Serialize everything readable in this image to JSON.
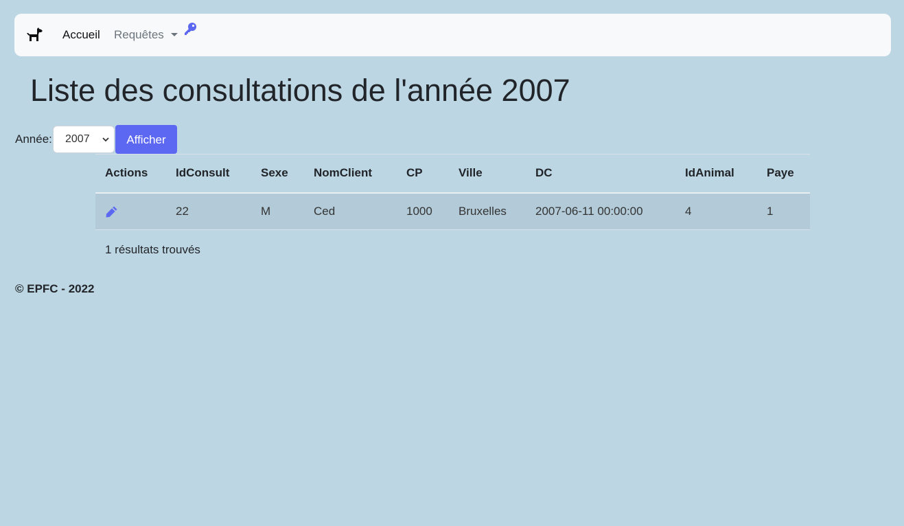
{
  "navbar": {
    "logo_icon": "dog-icon",
    "home_label": "Accueil",
    "requests_label": "Requêtes",
    "key_icon": "key-icon",
    "key_color": "#5c67f2"
  },
  "page": {
    "title": "Liste des consultations de l'année 2007"
  },
  "form": {
    "year_label": "Année:",
    "year_selected": "2007",
    "submit_label": "Afficher",
    "submit_color": "#5c67f2"
  },
  "table": {
    "headers": [
      "Actions",
      "IdConsult",
      "Sexe",
      "NomClient",
      "CP",
      "Ville",
      "DC",
      "IdAnimal",
      "Paye"
    ],
    "rows": [
      {
        "action_icon": "pencil-icon",
        "IdConsult": "22",
        "Sexe": "M",
        "NomClient": "Ced",
        "CP": "1000",
        "Ville": "Bruxelles",
        "DC": "2007-06-11 00:00:00",
        "IdAnimal": "4",
        "Paye": "1"
      }
    ],
    "results_text": "1 résultats trouvés"
  },
  "footer": {
    "text": "© EPFC - 2022"
  }
}
